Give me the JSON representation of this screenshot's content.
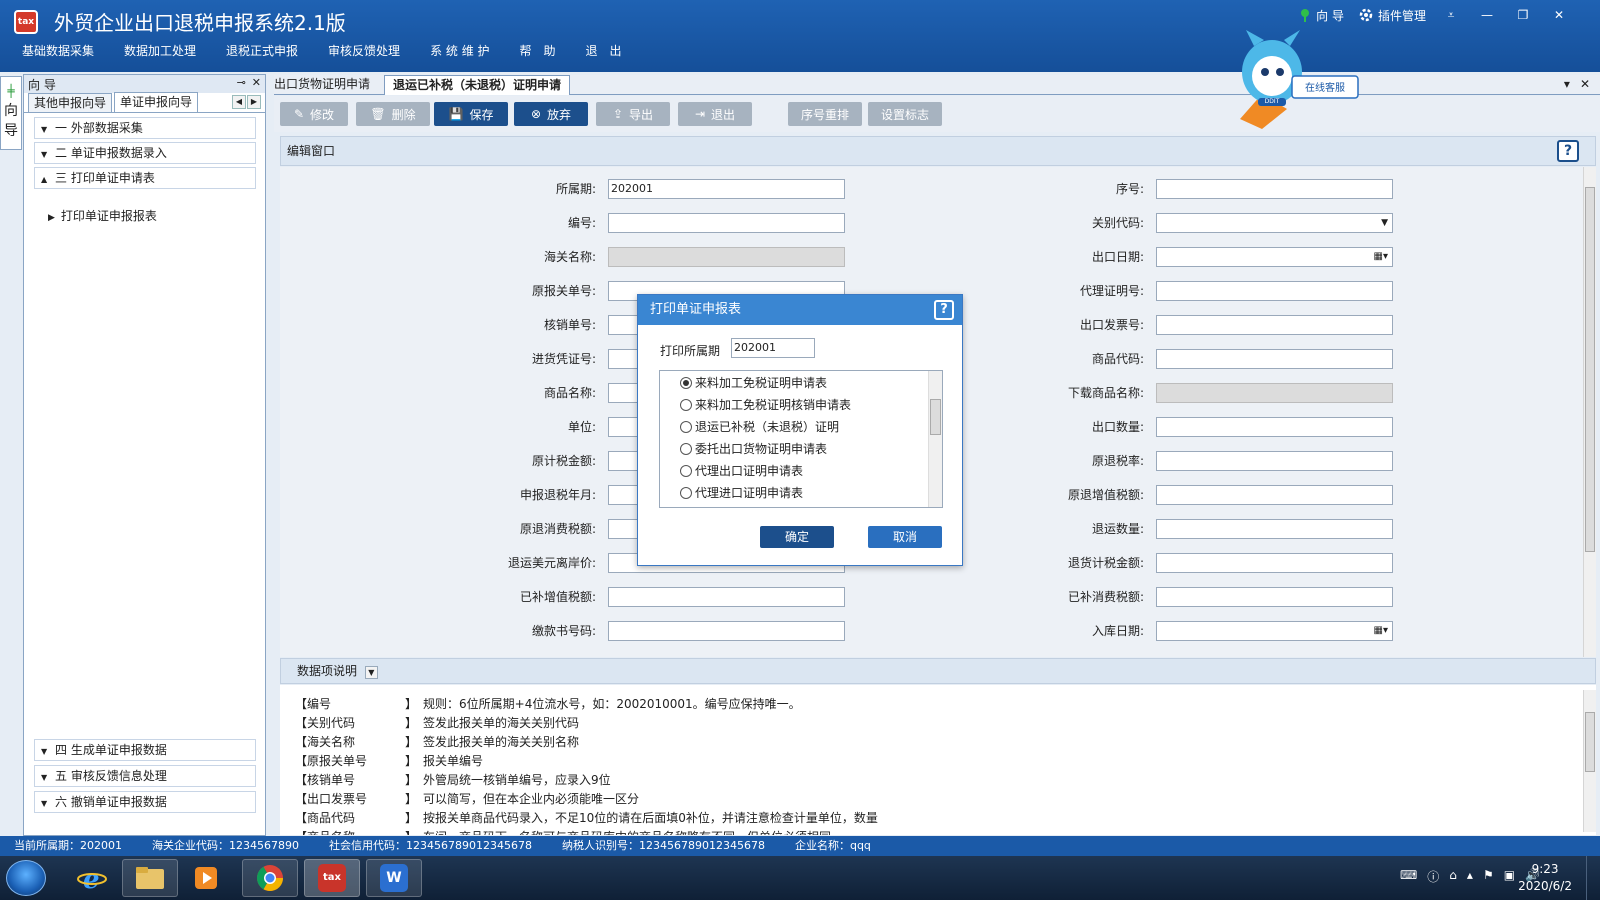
{
  "app": {
    "title": "外贸企业出口退税申报系统2.1版",
    "logo_text": "tax",
    "guide_link": "向 导",
    "plugin_link": "插件管理"
  },
  "menu": [
    "基础数据采集",
    "数据加工处理",
    "退税正式申报",
    "审核反馈处理",
    "系 统 维 护",
    "帮　助",
    "退　出"
  ],
  "mascot": {
    "badge": "在线客服",
    "brand": "DDIT"
  },
  "side_tab": {
    "label": "向\n导"
  },
  "nav": {
    "header": "向 导",
    "tabs": [
      "其他申报向导",
      "单证申报向导"
    ],
    "groups": [
      {
        "label": "一  外部数据采集",
        "expanded": false
      },
      {
        "label": "二  单证申报数据录入",
        "expanded": false
      },
      {
        "label": "三  打印单证申请表",
        "expanded": true
      },
      {
        "label": "四  生成单证申报数据",
        "expanded": false
      },
      {
        "label": "五  审核反馈信息处理",
        "expanded": false
      },
      {
        "label": "六  撤销单证申报数据",
        "expanded": false
      }
    ],
    "sub_item": "打印单证申报报表"
  },
  "content_tabs": [
    "出口货物证明申请",
    "退运已补税（未退税）证明申请"
  ],
  "toolbar": [
    "修改",
    "删除",
    "保存",
    "放弃",
    "导出",
    "退出",
    "序号重排",
    "设置标志"
  ],
  "edit_window": {
    "title": "编辑窗口"
  },
  "form": {
    "left": [
      {
        "label": "所属期:",
        "value": "202001",
        "disabled": false
      },
      {
        "label": "编号:",
        "value": "",
        "disabled": false
      },
      {
        "label": "海关名称:",
        "value": "",
        "disabled": true
      },
      {
        "label": "原报关单号:",
        "value": "",
        "disabled": false
      },
      {
        "label": "核销单号:",
        "value": "",
        "disabled": false
      },
      {
        "label": "进货凭证号:",
        "value": "",
        "disabled": false
      },
      {
        "label": "商品名称:",
        "value": "",
        "disabled": false
      },
      {
        "label": "单位:",
        "value": "",
        "disabled": false
      },
      {
        "label": "原计税金额:",
        "value": "",
        "disabled": false
      },
      {
        "label": "申报退税年月:",
        "value": "",
        "disabled": false
      },
      {
        "label": "原退消费税额:",
        "value": "",
        "disabled": false
      },
      {
        "label": "退运美元离岸价:",
        "value": "",
        "disabled": false
      },
      {
        "label": "已补增值税额:",
        "value": "",
        "disabled": false
      },
      {
        "label": "缴款书号码:",
        "value": "",
        "disabled": false
      }
    ],
    "right": [
      {
        "label": "序号:",
        "value": "",
        "disabled": false,
        "kind": "text"
      },
      {
        "label": "关别代码:",
        "value": "",
        "disabled": false,
        "kind": "select"
      },
      {
        "label": "出口日期:",
        "value": "",
        "disabled": false,
        "kind": "date"
      },
      {
        "label": "代理证明号:",
        "value": "",
        "disabled": false,
        "kind": "text"
      },
      {
        "label": "出口发票号:",
        "value": "",
        "disabled": false,
        "kind": "text"
      },
      {
        "label": "商品代码:",
        "value": "",
        "disabled": false,
        "kind": "text"
      },
      {
        "label": "下载商品名称:",
        "value": "",
        "disabled": true,
        "kind": "text"
      },
      {
        "label": "出口数量:",
        "value": "",
        "disabled": false,
        "kind": "text"
      },
      {
        "label": "原退税率:",
        "value": "",
        "disabled": false,
        "kind": "text"
      },
      {
        "label": "原退增值税额:",
        "value": "",
        "disabled": false,
        "kind": "text"
      },
      {
        "label": "退运数量:",
        "value": "",
        "disabled": false,
        "kind": "text"
      },
      {
        "label": "退货计税金额:",
        "value": "",
        "disabled": false,
        "kind": "text"
      },
      {
        "label": "已补消费税额:",
        "value": "",
        "disabled": false,
        "kind": "text"
      },
      {
        "label": "入库日期:",
        "value": "",
        "disabled": false,
        "kind": "date"
      }
    ]
  },
  "description": {
    "title": "数据项说明",
    "rows": [
      {
        "key": "【编号",
        "val": "】　规则：6位所属期+4位流水号，如：2002010001。编号应保持唯一。"
      },
      {
        "key": "【关别代码",
        "val": "】　签发此报关单的海关关别代码"
      },
      {
        "key": "【海关名称",
        "val": "】　签发此报关单的海关关别名称"
      },
      {
        "key": "【原报关单号",
        "val": "】　报关单编号"
      },
      {
        "key": "【核销单号",
        "val": "】　外管局统一核销单编号，应录入9位"
      },
      {
        "key": "【出口发票号",
        "val": "】　可以简写，但在本企业内必须能唯一区分"
      },
      {
        "key": "【商品代码",
        "val": "】　按报关单商品代码录入，不足10位的请在后面填0补位，并请注意检查计量单位，数量"
      },
      {
        "key": "【商品名称",
        "val": "】　车间，商品码下，名称可与商品码库中的商品名称略有不同，但单位必须相同"
      }
    ]
  },
  "status": {
    "period": "当前所属期：202001",
    "customs_code": "海关企业代码：1234567890",
    "credit_code": "社会信用代码：123456789012345678",
    "taxpayer_id": "纳税人识别号：123456789012345678",
    "company": "企业名称：qqq"
  },
  "dialog": {
    "title": "打印单证申报表",
    "period_label": "打印所属期",
    "period_value": "202001",
    "options": [
      {
        "label": "来料加工免税证明申请表",
        "selected": true
      },
      {
        "label": "来料加工免税证明核销申请表",
        "selected": false
      },
      {
        "label": "退运已补税（未退税）证明",
        "selected": false
      },
      {
        "label": "委托出口货物证明申请表",
        "selected": false
      },
      {
        "label": "代理出口证明申请表",
        "selected": false
      },
      {
        "label": "代理进口证明申请表",
        "selected": false
      }
    ],
    "ok": "确定",
    "cancel": "取消"
  },
  "taskbar": {
    "time": "9:23",
    "date": "2020/6/2",
    "tax_app_label": "tax",
    "wps_label": "W"
  },
  "colors": {
    "title_bar": "#1f62b3",
    "primary_button": "#1c4f8c",
    "dialog_title": "#3a86d2",
    "status_bar": "#1b5aa8"
  }
}
